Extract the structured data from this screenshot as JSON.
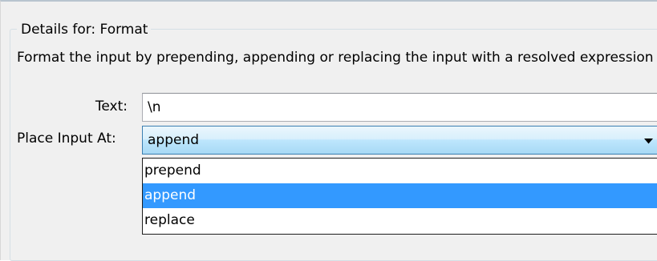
{
  "details": {
    "group_title": "Details for: Format",
    "description": "Format the input by prepending, appending or replacing the input with a resolved expression"
  },
  "fields": {
    "text_label": "Text:",
    "text_value": "\\n",
    "place_label": "Place Input At:",
    "place_value": "append"
  },
  "dropdown": {
    "options": [
      "prepend",
      "append",
      "replace"
    ],
    "selected_index": 1
  },
  "icons": {
    "combo_arrow": "chevron-down-icon"
  },
  "colors": {
    "selection": "#3399ff",
    "combo_border": "#3c7fb1",
    "panel_background": "#f0f0f0"
  }
}
